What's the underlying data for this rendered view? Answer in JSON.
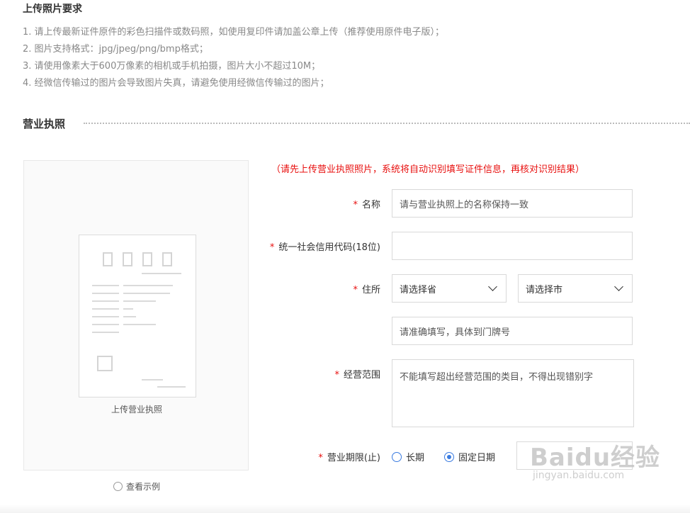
{
  "requirements": {
    "title": "上传照片要求",
    "items": [
      "1. 请上传最新证件原件的彩色扫描件或数码照，如使用复印件请加盖公章上传（推荐使用原件电子版）；",
      "2. 图片支持格式：jpg/jpeg/png/bmp格式；",
      "3. 请使用像素大于600万像素的相机或手机拍摄，图片大小不超过10M；",
      "4. 经微信传输过的图片会导致图片失真，请避免使用经微信传输过的图片；"
    ]
  },
  "section": {
    "title": "营业执照"
  },
  "upload": {
    "label": "上传营业执照",
    "view_example": "查看示例"
  },
  "form": {
    "hint": "（请先上传营业执照照片，系统将自动识别填写证件信息，再核对识别结果）",
    "required_mark": "*",
    "name": {
      "label": "名称",
      "placeholder": "请与营业执照上的名称保持一致"
    },
    "credit_code": {
      "label": "统一社会信用代码(18位)",
      "placeholder": ""
    },
    "address": {
      "label": "住所",
      "province": "请选择省",
      "city": "请选择市",
      "detail_placeholder": "请准确填写，具体到门牌号"
    },
    "scope": {
      "label": "经营范围",
      "placeholder": "不能填写超出经营范围的类目，不得出现错别字"
    },
    "term": {
      "label": "营业期限(止)",
      "option_long": "长期",
      "option_fixed": "固定日期",
      "selected": "固定日期"
    }
  },
  "watermark": {
    "main": "Baidu经验",
    "sub": "jingyan.baidu.com"
  },
  "colors": {
    "required": "#e8100f",
    "accent": "#3a7be0",
    "muted_text": "#888888"
  }
}
